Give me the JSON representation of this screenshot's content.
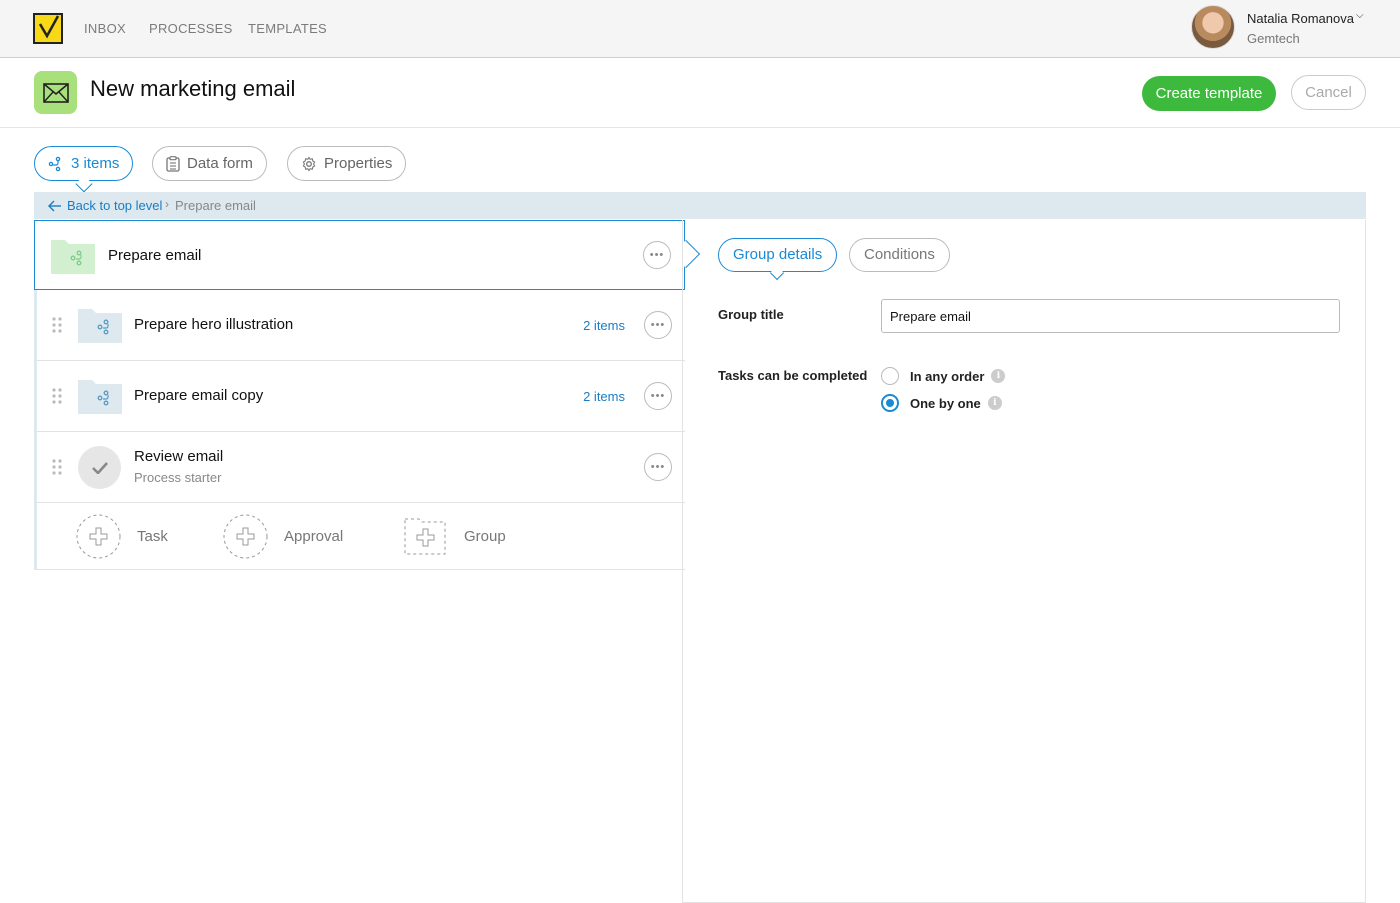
{
  "nav": {
    "items": [
      "INBOX",
      "PROCESSES",
      "TEMPLATES"
    ],
    "user": {
      "name": "Natalia Romanova",
      "org": "Gemtech"
    }
  },
  "header": {
    "title": "New marketing email",
    "create_label": "Create template",
    "cancel_label": "Cancel"
  },
  "tabs": [
    {
      "label": "3 items",
      "icon": "flow-icon",
      "active": true
    },
    {
      "label": "Data form",
      "icon": "clipboard-icon",
      "active": false
    },
    {
      "label": "Properties",
      "icon": "gear-icon",
      "active": false
    }
  ],
  "breadcrumb": {
    "back": "Back to top level",
    "current": "Prepare email"
  },
  "list": {
    "selected_title": "Prepare email",
    "items": [
      {
        "title": "Prepare hero illustration",
        "count": "2 items"
      },
      {
        "title": "Prepare email copy",
        "count": "2 items"
      },
      {
        "title": "Review email",
        "subtitle": "Process starter"
      }
    ],
    "add": {
      "task": "Task",
      "approval": "Approval",
      "group": "Group"
    }
  },
  "details": {
    "tabs": {
      "group_details": "Group details",
      "conditions": "Conditions"
    },
    "group_title_label": "Group title",
    "group_title_value": "Prepare email",
    "completion_label": "Tasks can be completed",
    "options": {
      "any_order": "In any order",
      "one_by_one": "One by one"
    },
    "info_glyph": "i"
  },
  "colors": {
    "accent": "#1a8ad4",
    "create": "#3dba3d",
    "icon_bg": "#a8e07c"
  }
}
